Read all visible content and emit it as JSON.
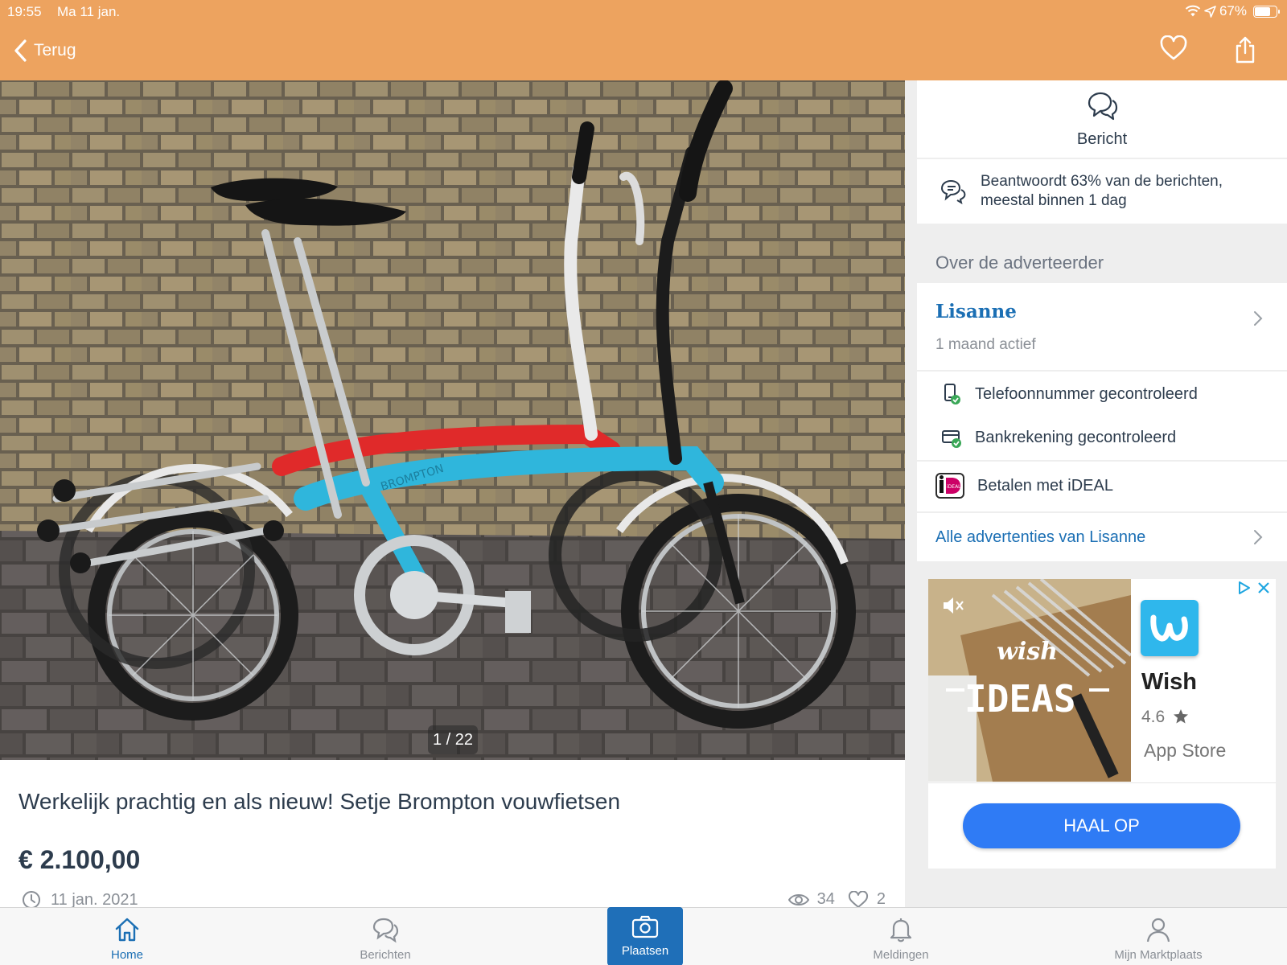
{
  "status_bar": {
    "time": "19:55",
    "date": "Ma 11 jan.",
    "battery": "67%"
  },
  "header": {
    "back_label": "Terug"
  },
  "photo": {
    "counter": "1 / 22",
    "frame_brand": "BROMPTON"
  },
  "listing": {
    "title": "Werkelijk prachtig en als nieuw! Setje Brompton vouwfietsen",
    "price": "€ 2.100,00",
    "date": "11 jan. 2021",
    "views": "34",
    "likes": "2"
  },
  "sidebar": {
    "message_label": "Bericht",
    "reply_rate": "Beantwoordt 63% van de berichten, meestal binnen 1 dag",
    "section_title": "Over de adverteerder",
    "advertiser_name": "Lisanne",
    "advertiser_active": "1 maand actief",
    "verified_phone": "Telefoonnummer gecontroleerd",
    "verified_bank": "Bankrekening gecontroleerd",
    "ideal": "Betalen met iDEAL",
    "all_ads": "Alle advertenties van Lisanne"
  },
  "ad": {
    "image_text_1": "wish",
    "image_text_2": "IDEAS",
    "app_name": "Wish",
    "rating": "4.6",
    "store": "App Store",
    "cta": "HAAL OP"
  },
  "bottom_nav": {
    "home": "Home",
    "messages": "Berichten",
    "place": "Plaatsen",
    "notifications": "Meldingen",
    "my": "Mijn Marktplaats"
  },
  "colors": {
    "header": "#eda35f",
    "link": "#1b6fb4",
    "cta": "#2f7bf5",
    "place_button": "#1f6fb8",
    "frame_blue": "#2fb6dc",
    "frame_red": "#e02a2a"
  },
  "icons": [
    "back-chevron-icon",
    "heart-icon",
    "share-icon",
    "chat-icon",
    "reply-rate-icon",
    "chevron-right-icon",
    "phone-check-icon",
    "bank-check-icon",
    "ideal-logo-icon",
    "clock-icon",
    "eye-icon",
    "heart-outline-icon",
    "home-icon",
    "messages-icon",
    "camera-icon",
    "bell-icon",
    "person-icon",
    "mute-icon",
    "adchoices-icon",
    "close-icon",
    "star-icon"
  ]
}
